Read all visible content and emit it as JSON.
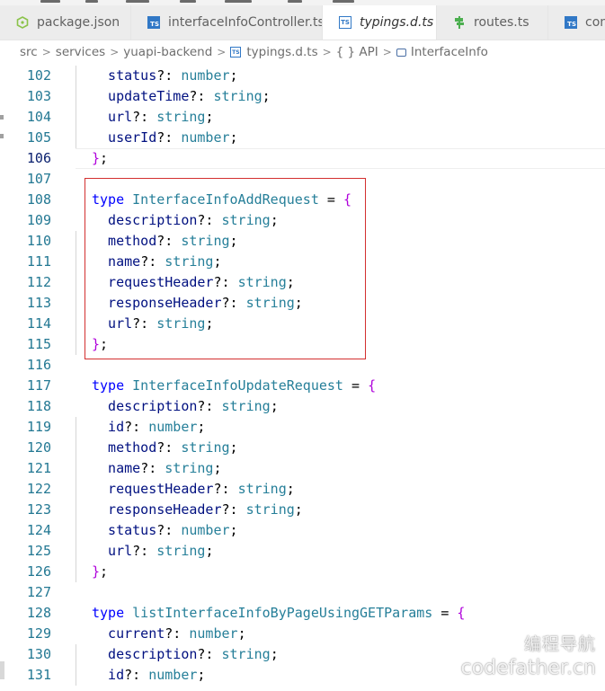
{
  "tabs": [
    {
      "label": "package.json",
      "icon": "json-icon",
      "active": false
    },
    {
      "label": "interfaceInfoController.ts",
      "icon": "typescript-file-icon",
      "active": false
    },
    {
      "label": "typings.d.ts",
      "icon": "typescript-file-icon",
      "active": true
    },
    {
      "label": "routes.ts",
      "icon": "route-icon",
      "active": false
    },
    {
      "label": "confi",
      "icon": "typescript-file-icon",
      "active": false
    }
  ],
  "close_glyph": "×",
  "ts_icon_text": "TS",
  "breadcrumb": {
    "items": [
      "src",
      "services",
      "yuapi-backend",
      "typings.d.ts",
      "{ } API",
      "InterfaceInfo"
    ],
    "separator": ">"
  },
  "editor": {
    "current_line": "106",
    "lines": [
      {
        "num": "102",
        "tokens": [
          {
            "t": "  status",
            "c": "id"
          },
          {
            "t": "?: ",
            "c": "op"
          },
          {
            "t": "number",
            "c": "ty"
          },
          {
            "t": ";",
            "c": "op"
          }
        ]
      },
      {
        "num": "103",
        "tokens": [
          {
            "t": "  updateTime",
            "c": "id"
          },
          {
            "t": "?: ",
            "c": "op"
          },
          {
            "t": "string",
            "c": "ty"
          },
          {
            "t": ";",
            "c": "op"
          }
        ]
      },
      {
        "num": "104",
        "tokens": [
          {
            "t": "  url",
            "c": "id"
          },
          {
            "t": "?: ",
            "c": "op"
          },
          {
            "t": "string",
            "c": "ty"
          },
          {
            "t": ";",
            "c": "op"
          }
        ]
      },
      {
        "num": "105",
        "tokens": [
          {
            "t": "  userId",
            "c": "id"
          },
          {
            "t": "?: ",
            "c": "op"
          },
          {
            "t": "number",
            "c": "ty"
          },
          {
            "t": ";",
            "c": "op"
          }
        ]
      },
      {
        "num": "106",
        "tokens": [
          {
            "t": "}",
            "c": "br"
          },
          {
            "t": ";",
            "c": "op"
          }
        ]
      },
      {
        "num": "107",
        "tokens": []
      },
      {
        "num": "108",
        "tokens": [
          {
            "t": "type ",
            "c": "kw"
          },
          {
            "t": "InterfaceInfoAddRequest",
            "c": "ty"
          },
          {
            "t": " = ",
            "c": "op"
          },
          {
            "t": "{",
            "c": "br"
          }
        ]
      },
      {
        "num": "109",
        "tokens": [
          {
            "t": "  description",
            "c": "id"
          },
          {
            "t": "?: ",
            "c": "op"
          },
          {
            "t": "string",
            "c": "ty"
          },
          {
            "t": ";",
            "c": "op"
          }
        ]
      },
      {
        "num": "110",
        "tokens": [
          {
            "t": "  method",
            "c": "id"
          },
          {
            "t": "?: ",
            "c": "op"
          },
          {
            "t": "string",
            "c": "ty"
          },
          {
            "t": ";",
            "c": "op"
          }
        ]
      },
      {
        "num": "111",
        "tokens": [
          {
            "t": "  name",
            "c": "id"
          },
          {
            "t": "?: ",
            "c": "op"
          },
          {
            "t": "string",
            "c": "ty"
          },
          {
            "t": ";",
            "c": "op"
          }
        ]
      },
      {
        "num": "112",
        "tokens": [
          {
            "t": "  requestHeader",
            "c": "id"
          },
          {
            "t": "?: ",
            "c": "op"
          },
          {
            "t": "string",
            "c": "ty"
          },
          {
            "t": ";",
            "c": "op"
          }
        ]
      },
      {
        "num": "113",
        "tokens": [
          {
            "t": "  responseHeader",
            "c": "id"
          },
          {
            "t": "?: ",
            "c": "op"
          },
          {
            "t": "string",
            "c": "ty"
          },
          {
            "t": ";",
            "c": "op"
          }
        ]
      },
      {
        "num": "114",
        "tokens": [
          {
            "t": "  url",
            "c": "id"
          },
          {
            "t": "?: ",
            "c": "op"
          },
          {
            "t": "string",
            "c": "ty"
          },
          {
            "t": ";",
            "c": "op"
          }
        ]
      },
      {
        "num": "115",
        "tokens": [
          {
            "t": "}",
            "c": "br"
          },
          {
            "t": ";",
            "c": "op"
          }
        ]
      },
      {
        "num": "116",
        "tokens": []
      },
      {
        "num": "117",
        "tokens": [
          {
            "t": "type ",
            "c": "kw"
          },
          {
            "t": "InterfaceInfoUpdateRequest",
            "c": "ty"
          },
          {
            "t": " = ",
            "c": "op"
          },
          {
            "t": "{",
            "c": "br"
          }
        ]
      },
      {
        "num": "118",
        "tokens": [
          {
            "t": "  description",
            "c": "id"
          },
          {
            "t": "?: ",
            "c": "op"
          },
          {
            "t": "string",
            "c": "ty"
          },
          {
            "t": ";",
            "c": "op"
          }
        ]
      },
      {
        "num": "119",
        "tokens": [
          {
            "t": "  id",
            "c": "id"
          },
          {
            "t": "?: ",
            "c": "op"
          },
          {
            "t": "number",
            "c": "ty"
          },
          {
            "t": ";",
            "c": "op"
          }
        ]
      },
      {
        "num": "120",
        "tokens": [
          {
            "t": "  method",
            "c": "id"
          },
          {
            "t": "?: ",
            "c": "op"
          },
          {
            "t": "string",
            "c": "ty"
          },
          {
            "t": ";",
            "c": "op"
          }
        ]
      },
      {
        "num": "121",
        "tokens": [
          {
            "t": "  name",
            "c": "id"
          },
          {
            "t": "?: ",
            "c": "op"
          },
          {
            "t": "string",
            "c": "ty"
          },
          {
            "t": ";",
            "c": "op"
          }
        ]
      },
      {
        "num": "122",
        "tokens": [
          {
            "t": "  requestHeader",
            "c": "id"
          },
          {
            "t": "?: ",
            "c": "op"
          },
          {
            "t": "string",
            "c": "ty"
          },
          {
            "t": ";",
            "c": "op"
          }
        ]
      },
      {
        "num": "123",
        "tokens": [
          {
            "t": "  responseHeader",
            "c": "id"
          },
          {
            "t": "?: ",
            "c": "op"
          },
          {
            "t": "string",
            "c": "ty"
          },
          {
            "t": ";",
            "c": "op"
          }
        ]
      },
      {
        "num": "124",
        "tokens": [
          {
            "t": "  status",
            "c": "id"
          },
          {
            "t": "?: ",
            "c": "op"
          },
          {
            "t": "number",
            "c": "ty"
          },
          {
            "t": ";",
            "c": "op"
          }
        ]
      },
      {
        "num": "125",
        "tokens": [
          {
            "t": "  url",
            "c": "id"
          },
          {
            "t": "?: ",
            "c": "op"
          },
          {
            "t": "string",
            "c": "ty"
          },
          {
            "t": ";",
            "c": "op"
          }
        ]
      },
      {
        "num": "126",
        "tokens": [
          {
            "t": "}",
            "c": "br"
          },
          {
            "t": ";",
            "c": "op"
          }
        ]
      },
      {
        "num": "127",
        "tokens": []
      },
      {
        "num": "128",
        "tokens": [
          {
            "t": "type ",
            "c": "kw"
          },
          {
            "t": "listInterfaceInfoByPageUsingGETParams",
            "c": "ty"
          },
          {
            "t": " = ",
            "c": "op"
          },
          {
            "t": "{",
            "c": "br"
          }
        ]
      },
      {
        "num": "129",
        "tokens": [
          {
            "t": "  current",
            "c": "id"
          },
          {
            "t": "?: ",
            "c": "op"
          },
          {
            "t": "number",
            "c": "ty"
          },
          {
            "t": ";",
            "c": "op"
          }
        ]
      },
      {
        "num": "130",
        "tokens": [
          {
            "t": "  description",
            "c": "id"
          },
          {
            "t": "?: ",
            "c": "op"
          },
          {
            "t": "string",
            "c": "ty"
          },
          {
            "t": ";",
            "c": "op"
          }
        ]
      },
      {
        "num": "131",
        "tokens": [
          {
            "t": "  id",
            "c": "id"
          },
          {
            "t": "?: ",
            "c": "op"
          },
          {
            "t": "number",
            "c": "ty"
          },
          {
            "t": ";",
            "c": "op"
          }
        ]
      }
    ]
  },
  "highlight_color": "#d32f2f",
  "watermark": {
    "line1": "编程导航",
    "line2": "codefather.cn"
  }
}
